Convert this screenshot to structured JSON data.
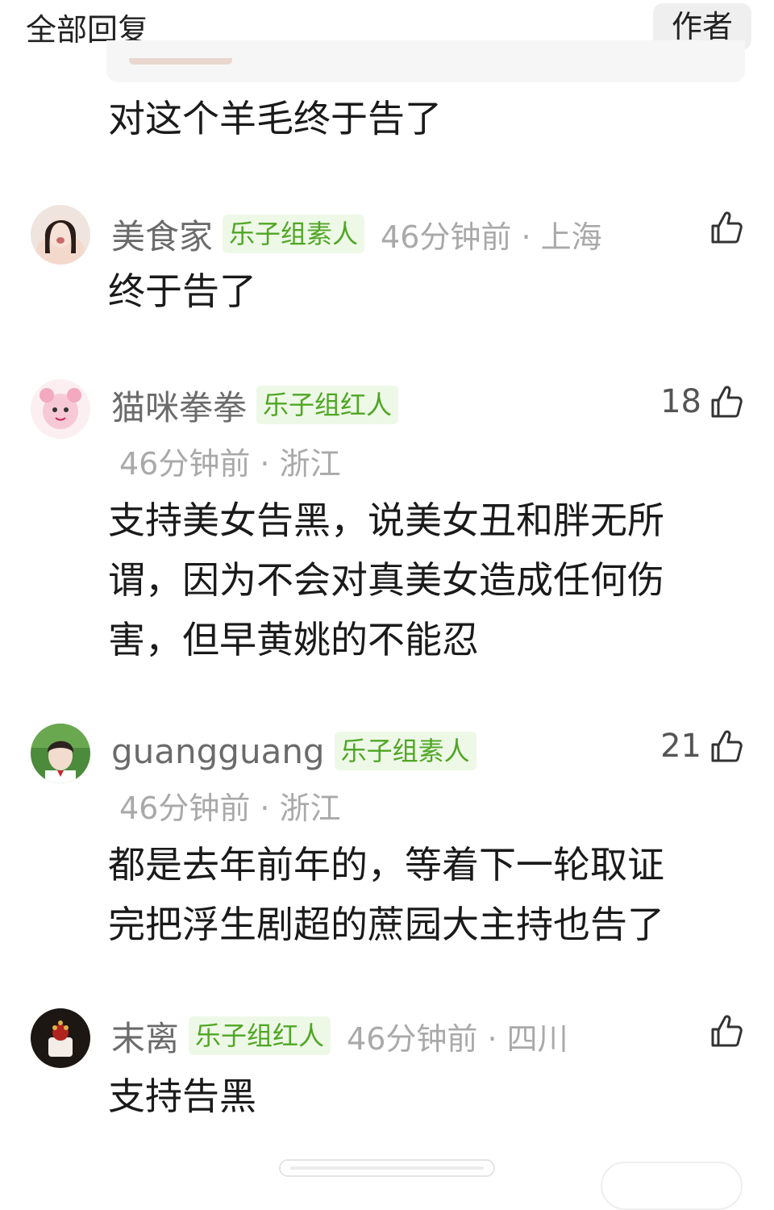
{
  "header": {
    "title": "全部回复",
    "author_filter": "作者"
  },
  "quoted_reply": {
    "text": "对这个羊毛终于告了"
  },
  "comments": [
    {
      "username": "美食家",
      "tag": "乐子组素人",
      "time_location": "46分钟前 · 上海",
      "likes": "",
      "avatar_icon": "avatar-girl-photo",
      "lines": [
        "终于告了"
      ]
    },
    {
      "username": "猫咪拳拳",
      "tag": "乐子组红人",
      "time_location": "46分钟前 · 浙江",
      "likes": "18",
      "avatar_icon": "avatar-anime-pink",
      "lines": [
        "支持美女告黑，说美女丑和胖无所",
        "谓，因为不会对真美女造成任何伤",
        "害，但早黄姚的不能忍"
      ]
    },
    {
      "username": "guangguang",
      "tag": "乐子组素人",
      "time_location": "46分钟前 · 浙江",
      "likes": "21",
      "avatar_icon": "avatar-boy-photo",
      "lines": [
        "都是去年前年的，等着下一轮取证",
        "完把浮生剧超的蔗园大主持也告了"
      ]
    },
    {
      "username": "末离",
      "tag": "乐子组红人",
      "time_location": "46分钟前 · 四川",
      "likes": "",
      "avatar_icon": "avatar-dark-photo",
      "lines": [
        "支持告黑"
      ]
    }
  ],
  "colors": {
    "tag_bg": "#eef8e7",
    "tag_text": "#4fa624",
    "meta_text": "#a9a9a9",
    "name_text": "#6b6b6b"
  }
}
